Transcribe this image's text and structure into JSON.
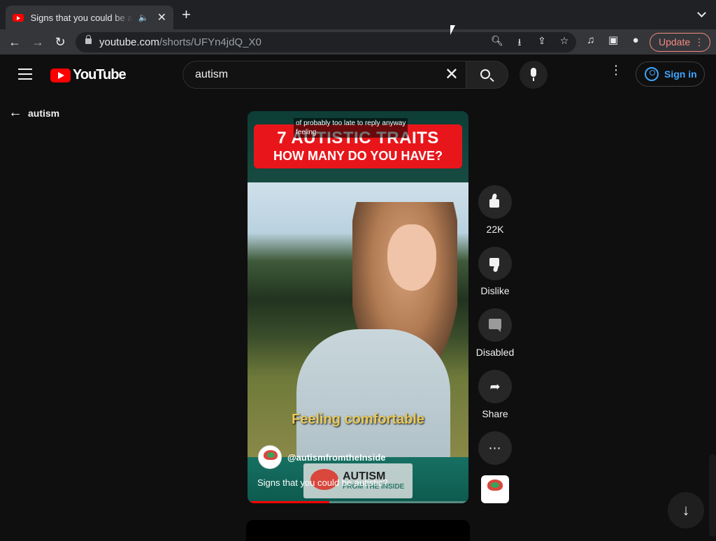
{
  "browser": {
    "tab_title": "Signs that you could be autistic?",
    "url_host": "youtube.com",
    "url_path": "/shorts/UFYn4jdQ_X0",
    "update_label": "Update",
    "icons": [
      "back-arrow-icon",
      "forward-arrow-icon",
      "reload-icon",
      "lock-icon",
      "zoom-icon",
      "install-icon",
      "share-icon",
      "star-icon",
      "media-icon",
      "sidepanel-icon",
      "profile-icon",
      "kebab-icon"
    ]
  },
  "masthead": {
    "logo_text": "YouTube",
    "search_value": "autism",
    "sign_in": "Sign in"
  },
  "back": {
    "label": "autism"
  },
  "short": {
    "caption_overlay_1": "of probably too late to reply anyway",
    "caption_overlay_2": "feeling",
    "banner_line1": "7 AUTISTIC TRAITS",
    "banner_line2": "HOW MANY DO YOU HAVE?",
    "subtitle": "Feeling comfortable",
    "channel": "@autismfromtheInside",
    "watermark_title": "AUTISM",
    "watermark_sub": "FROM THE INSIDE",
    "title": "Signs that you could be autistic?",
    "progress": 0.37
  },
  "actions": {
    "like_count": "22K",
    "dislike_label": "Dislike",
    "comments_label": "Disabled",
    "share_label": "Share"
  },
  "colors": {
    "accent": "#ff0000",
    "link": "#3ea6ff",
    "banner": "#e8161b"
  }
}
